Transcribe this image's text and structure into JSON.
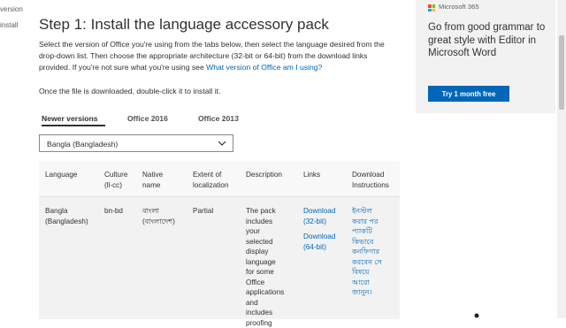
{
  "left_nav": {
    "item_1": "version",
    "item_2": "install"
  },
  "heading": "Step 1: Install the language accessory pack",
  "intro": {
    "text": "Select the version of Office you're using from the tabs below, then select the language desired from the drop-down list. Then choose the appropriate architecture (32-bit or 64-bit) from the download links provided. If you're not sure what you're using see ",
    "link": "What version of Office am I using?"
  },
  "install_note": "Once the file is downloaded, double-click it to install it.",
  "tabs": [
    "Newer versions",
    "Office 2016",
    "Office 2013"
  ],
  "language_select": {
    "value": "Bangla (Bangladesh)"
  },
  "table": {
    "headers": {
      "language": "Language",
      "culture_1": "Culture",
      "culture_2": "(ll-cc)",
      "native_1": "Native",
      "native_2": "name",
      "extent_1": "Extent of",
      "extent_2": "localization",
      "description": "Description",
      "links": "Links",
      "instructions_1": "Download",
      "instructions_2": "Instructions"
    },
    "row": {
      "language_1": "Bangla",
      "language_2": "(Bangladesh)",
      "culture": "bn-bd",
      "native_1": "বাংলা",
      "native_2": "(বাংলাদেশ)",
      "extent": "Partial",
      "description_lines": [
        "The pack",
        "includes",
        "your",
        "selected",
        "display",
        "language",
        "for some",
        "Office",
        "applications",
        "and",
        "includes",
        "proofing"
      ],
      "link_32_1": "Download",
      "link_32_2": "(32-bit)",
      "link_64_1": "Download",
      "link_64_2": "(64-bit)",
      "instruction_lines": [
        "ইনস্টল",
        "করার পর",
        "প্যাকটি",
        "কিভাবে",
        "কনফিগার",
        "করবেন সে",
        "বিষয়ে",
        "আরো",
        "জানুন।"
      ]
    }
  },
  "sidebar": {
    "brand": "Microsoft 365",
    "promo": "Go from good grammar to great style with Editor in Microsoft Word",
    "cta": "Try 1 month free"
  },
  "colors": {
    "link": "#0067b8",
    "cta_bg": "#0067b8",
    "logo": [
      "#f25022",
      "#7fba00",
      "#00a4ef",
      "#ffb900"
    ]
  }
}
